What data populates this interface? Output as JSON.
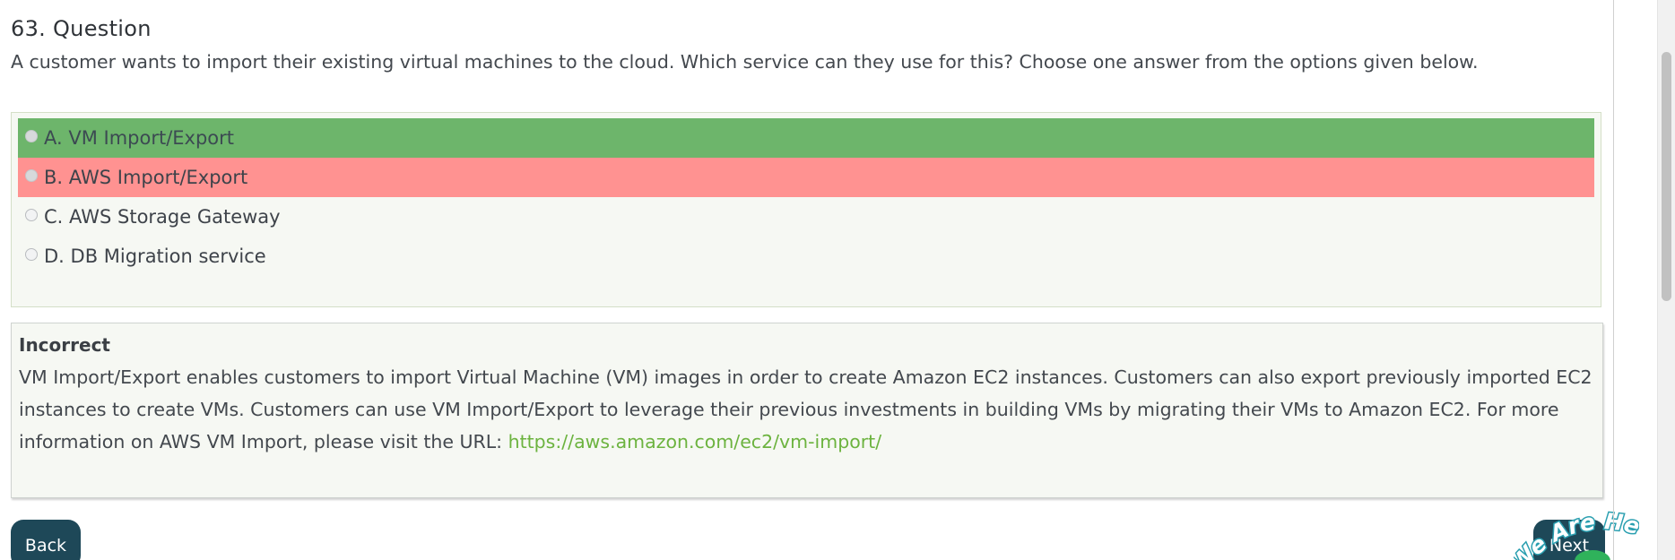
{
  "question": {
    "title": "63. Question",
    "text": "A customer wants to import their existing virtual machines to the cloud. Which service can they use for this? Choose one answer from the options given below."
  },
  "options": [
    {
      "label": "A. VM Import/Export",
      "state": "correct"
    },
    {
      "label": "B. AWS Import/Export",
      "state": "incorrect-selected"
    },
    {
      "label": "C. AWS Storage Gateway",
      "state": "neutral"
    },
    {
      "label": "D. DB Migration service",
      "state": "neutral"
    }
  ],
  "explanation": {
    "heading": "Incorrect",
    "body": "VM Import/Export enables customers to import Virtual Machine (VM) images in order to create Amazon EC2 instances. Customers can also export previously imported EC2 instances to create VMs. Customers can use VM Import/Export to leverage their previous investments in building VMs by migrating their VMs to Amazon EC2. For more information on AWS VM Import, please visit the URL: ",
    "link_text": "https://aws.amazon.com/ec2/vm-import/"
  },
  "nav": {
    "back_label": "Back",
    "next_label": "Next"
  },
  "badge": {
    "text": "We Are Here!"
  },
  "colors": {
    "correct": "#6db56b",
    "incorrect": "#ff9291",
    "button": "#1e4858",
    "link": "#6cb33f",
    "panel": "#f6f8f3"
  }
}
